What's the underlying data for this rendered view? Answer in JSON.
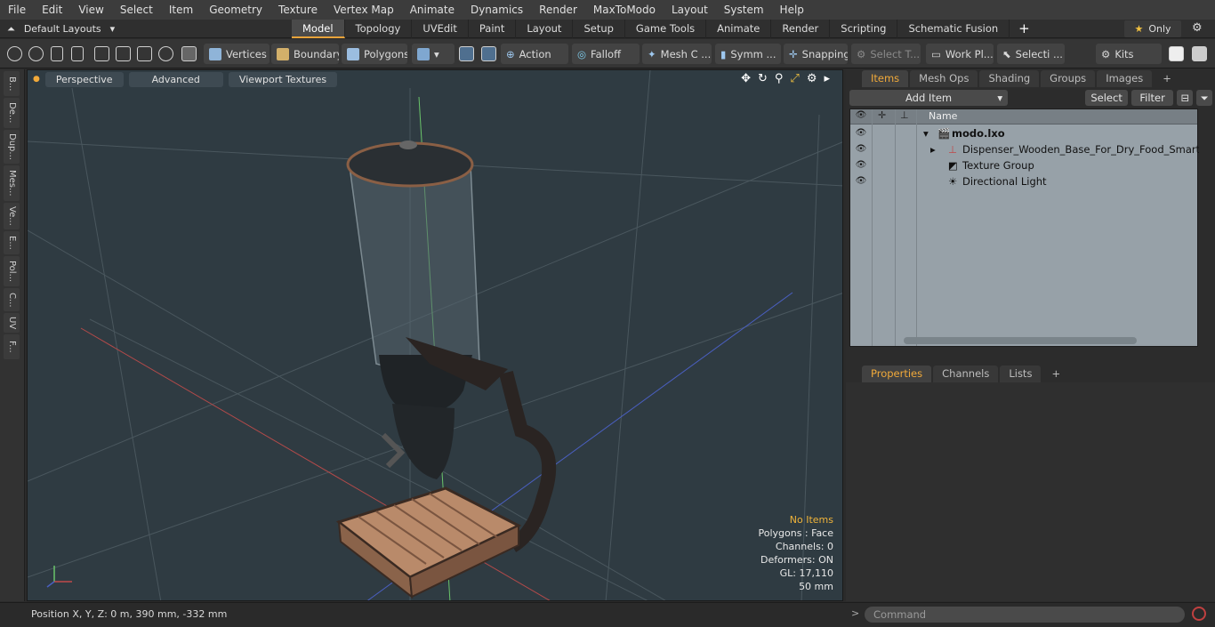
{
  "menu": [
    "File",
    "Edit",
    "View",
    "Select",
    "Item",
    "Geometry",
    "Texture",
    "Vertex Map",
    "Animate",
    "Dynamics",
    "Render",
    "MaxToModo",
    "Layout",
    "System",
    "Help"
  ],
  "layouts_label": "Default Layouts",
  "tabs": [
    "Model",
    "Topology",
    "UVEdit",
    "Paint",
    "Layout",
    "Setup",
    "Game Tools",
    "Animate",
    "Render",
    "Scripting",
    "Schematic Fusion"
  ],
  "only_label": "Only",
  "toolbar": {
    "vertices": "Vertices",
    "boundary": "Boundary",
    "polygons": "Polygons",
    "action": "Action",
    "falloff": "Falloff",
    "mesh": "Mesh C ...",
    "symm": "Symm ...",
    "snapping": "Snapping",
    "select_t": "Select T...",
    "workpl": "Work Pl...",
    "selecti": "Selecti ...",
    "kits": "Kits"
  },
  "left_tabs": [
    "B...",
    "De...",
    "Dup...",
    "Mes...",
    "Ve...",
    "E...",
    "Pol...",
    "C...",
    "UV",
    "F..."
  ],
  "viewport": {
    "perspective": "Perspective",
    "advanced": "Advanced",
    "textures": "Viewport Textures",
    "stats": {
      "items": "No Items",
      "polygons": "Polygons : Face",
      "channels": "Channels: 0",
      "deformers": "Deformers: ON",
      "gl": "GL: 17,110",
      "size": "50 mm"
    }
  },
  "right_tabs": [
    "Items",
    "Mesh Ops",
    "Shading",
    "Groups",
    "Images"
  ],
  "items_bar": {
    "add_item": "Add Item",
    "select": "Select",
    "filter": "Filter"
  },
  "list": {
    "header": "Name",
    "rows": [
      "modo.lxo",
      "Dispenser_Wooden_Base_For_Dry_Food_Smart_Sp ...",
      "Texture Group",
      "Directional Light"
    ]
  },
  "props_tabs": [
    "Properties",
    "Channels",
    "Lists"
  ],
  "status": {
    "position": "Position X, Y, Z:   0 m, 390 mm, -332 mm",
    "command": "Command"
  },
  "colors": {
    "accent": "#f0a93a",
    "viewport_bg": "#2f3b42",
    "list_bg": "#97a1a8"
  }
}
